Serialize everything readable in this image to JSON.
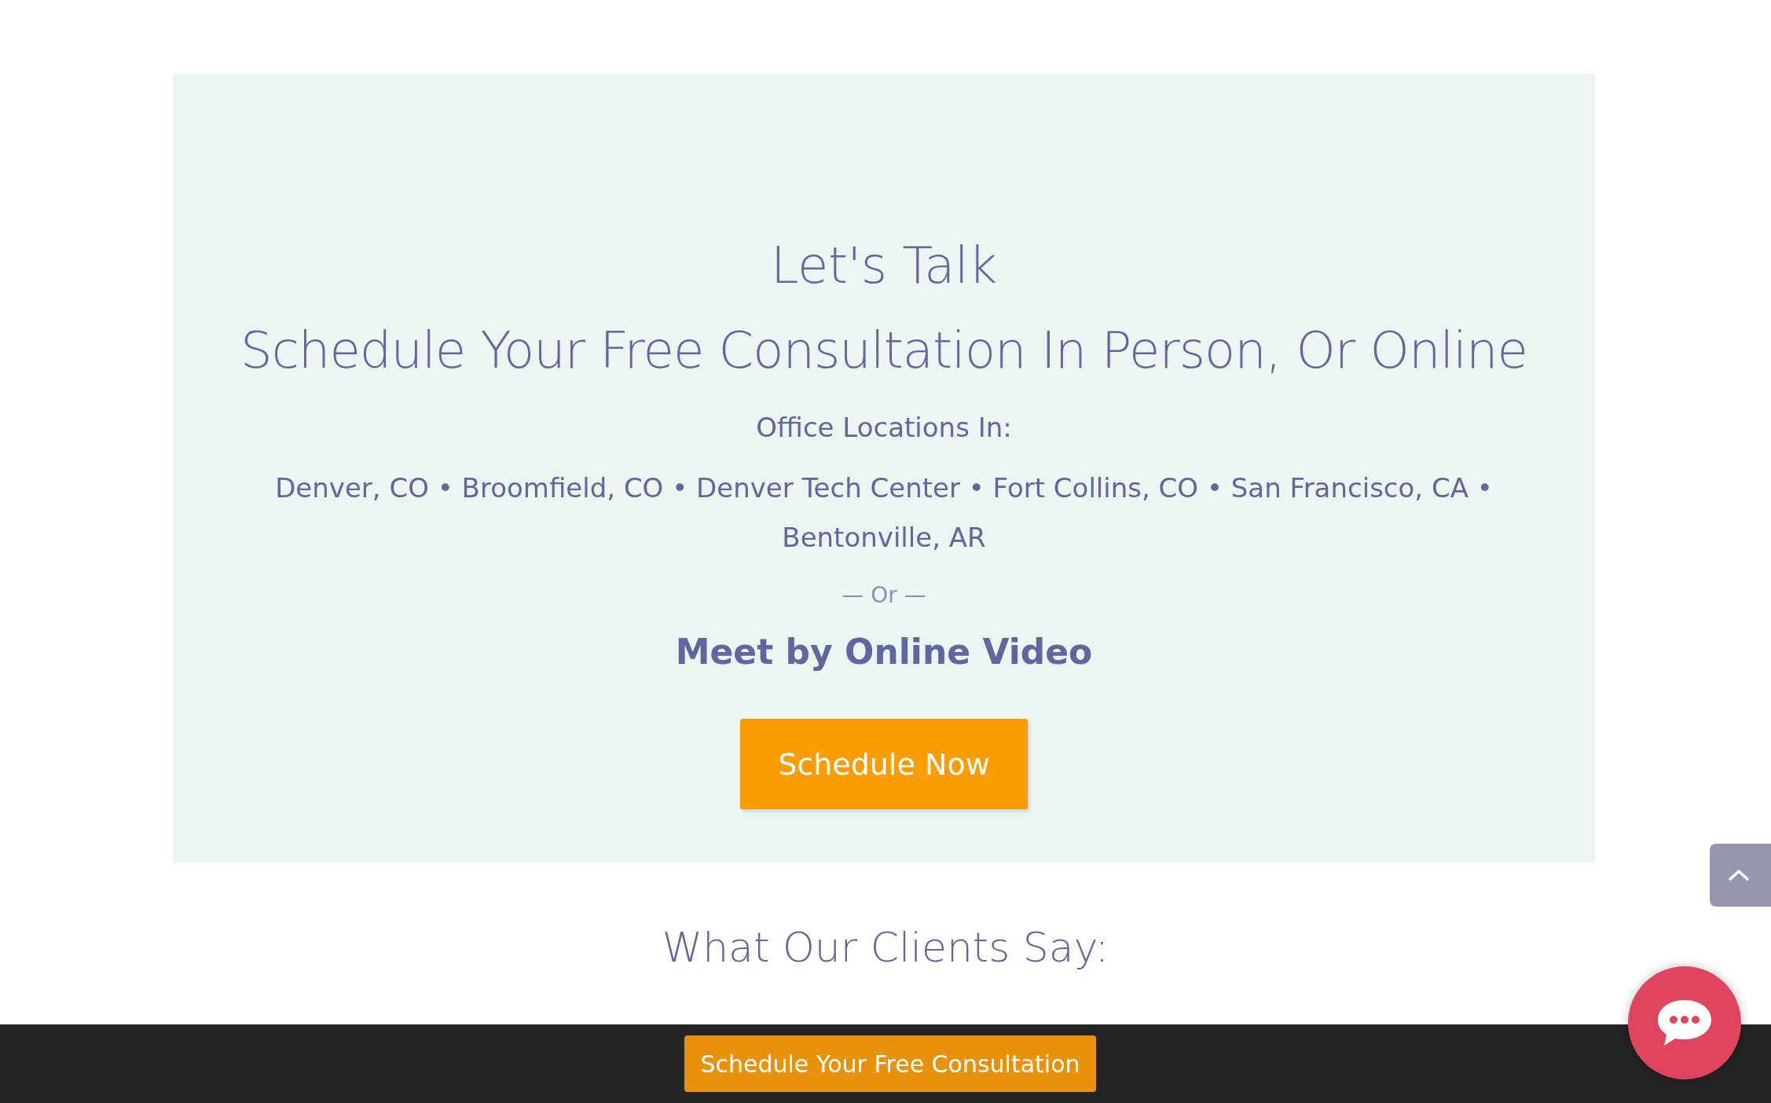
{
  "contact_panel": {
    "title": "Let's Talk",
    "subtitle": "Schedule Your Free Consultation In Person, Or Online",
    "locations_label": "Office Locations In:",
    "locations": [
      "Denver, CO • Broomfield, CO • Denver Tech Center • Fort Collins, CO • San Francisco, CA •",
      "Bentonville, AR"
    ],
    "separator": "— Or —",
    "video_heading": "Meet by Online Video",
    "button": "Schedule Now"
  },
  "testimonials": {
    "heading": "What Our Clients Say:"
  },
  "footer_bar": {
    "button": "Schedule Your Free Consultation"
  }
}
